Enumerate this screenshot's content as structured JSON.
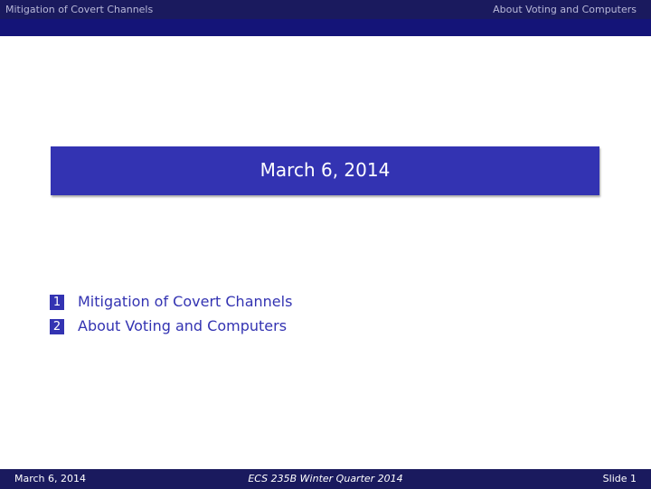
{
  "headline": {
    "left": "Mitigation of Covert Channels",
    "right": "About Voting and Computers"
  },
  "title": "March 6, 2014",
  "toc": [
    {
      "number": "1",
      "label": "Mitigation of Covert Channels"
    },
    {
      "number": "2",
      "label": "About Voting and Computers"
    }
  ],
  "footer": {
    "date": "March 6, 2014",
    "course": "ECS 235B Winter Quarter 2014",
    "slide": "Slide 1"
  },
  "colors": {
    "accent": "#3333b2",
    "header_bg": "#1a1a5e",
    "subbar_bg": "#141478"
  }
}
